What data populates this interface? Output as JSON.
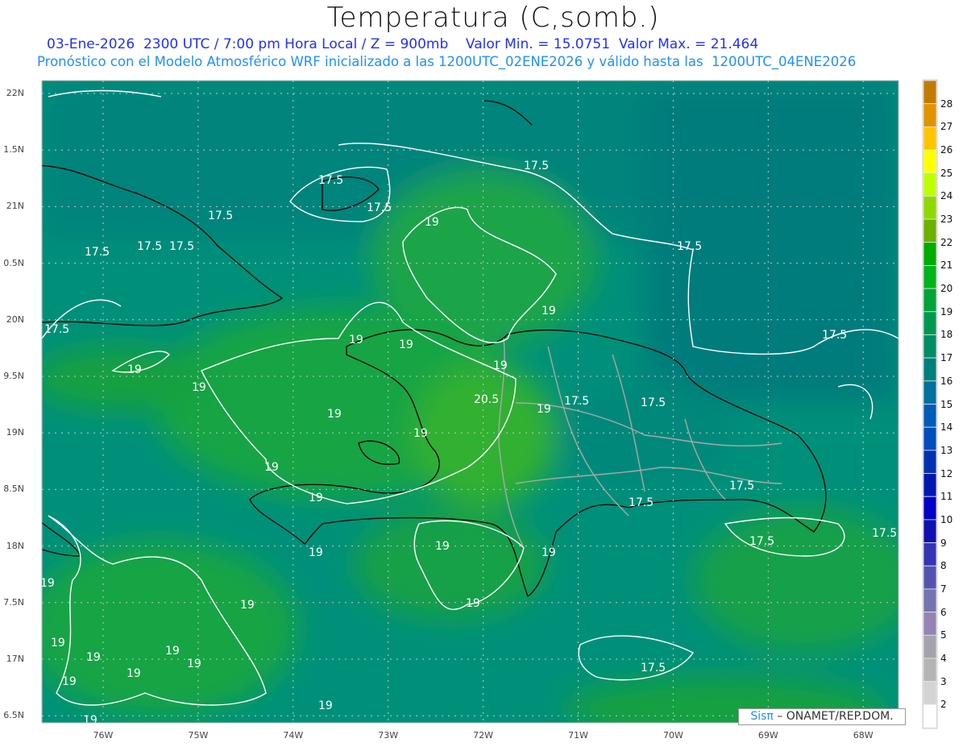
{
  "header": {
    "title": "Temperatura (C,somb.)",
    "line1": "03-Ene-2026  2300 UTC / 7:00 pm Hora Local / Z = 900mb    Valor Min. = 15.0751  Valor Max. = 21.464",
    "line2": "Pronóstico con el Modelo Atmosférico WRF inicializado a las 1200UTC_02ENE2026 y válido hasta las  1200UTC_04ENE2026"
  },
  "axes": {
    "lat_labels": [
      "22N",
      "1.5N",
      "21N",
      "0.5N",
      "20N",
      "9.5N",
      "19N",
      "8.5N",
      "18N",
      "7.5N",
      "17N",
      "6.5N"
    ],
    "lon_labels": [
      "76W",
      "75W",
      "74W",
      "73W",
      "72W",
      "71W",
      "70W",
      "69W",
      "68W"
    ]
  },
  "colorbar": {
    "labels": [
      "28",
      "27",
      "26",
      "25",
      "24",
      "23",
      "22",
      "21",
      "20",
      "19",
      "18",
      "17",
      "16",
      "15",
      "14",
      "13",
      "12",
      "11",
      "10",
      "9",
      "8",
      "7",
      "6",
      "5",
      "4",
      "3",
      "2"
    ],
    "colors": [
      "#c07c00",
      "#e09400",
      "#ffc400",
      "#ffff00",
      "#bcff00",
      "#90d800",
      "#6cb000",
      "#00ac00",
      "#00b41c",
      "#00a438",
      "#009850",
      "#008c64",
      "#007e7c",
      "#00709c",
      "#005cb8",
      "#004cbc",
      "#0030b0",
      "#0018b0",
      "#0000c8",
      "#1010b0",
      "#3434b4",
      "#5454b0",
      "#7474b0",
      "#9484b4",
      "#a4a4ac",
      "#b4b4b4",
      "#d4d4d4",
      "#ffffff"
    ]
  },
  "contours": {
    "labels": [
      "17.5",
      "19",
      "20.5"
    ]
  },
  "logo": {
    "sis": "Sisπ",
    "text": " –  ONAMET/REP.DOM."
  }
}
